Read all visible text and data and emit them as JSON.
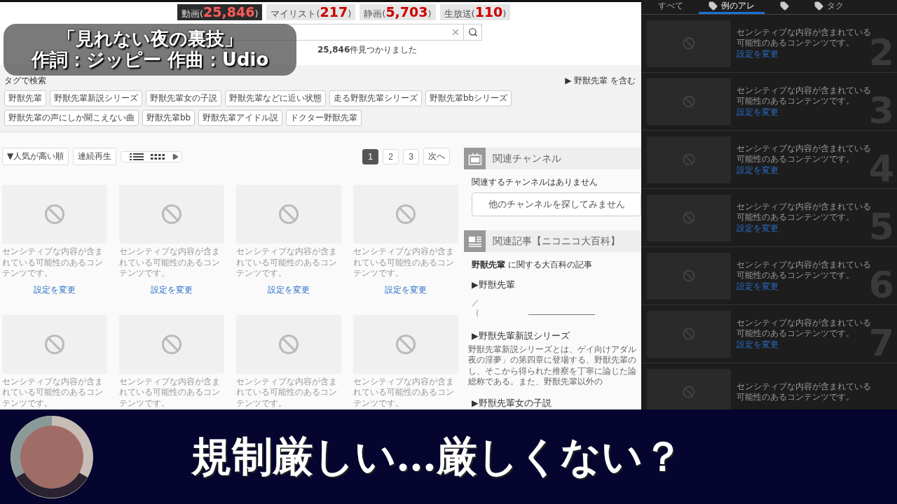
{
  "caption": {
    "title": "「見れない夜の裏技」",
    "credits": "作詞：ジッピー 作曲：Udio"
  },
  "count_tabs": [
    {
      "label": "動画(",
      "count": "25,846",
      "suffix": ")",
      "selected": true
    },
    {
      "label": "マイリスト(",
      "count": "217",
      "suffix": ")",
      "selected": false
    },
    {
      "label": "静画(",
      "count": "5,703",
      "suffix": ")",
      "selected": false
    },
    {
      "label": "生放送(",
      "count": "110",
      "suffix": ")",
      "selected": false
    }
  ],
  "result_text": "**25,846**件見つかりました",
  "tag_search": {
    "title": "タグで検索",
    "related": "▶ 野獣先輩 を含む"
  },
  "tags": [
    "野獣先輩",
    "野獣先輩新説シリーズ",
    "野獣先輩女の子説",
    "野獣先輩などに近い状態",
    "走る野獣先輩シリーズ",
    "野獣先輩bbシリーズ",
    "野獣先輩の声にしか聞こえない曲",
    "野獣先輩bb",
    "野獣先輩アイドル説",
    "ドクター野獣先輩"
  ],
  "toolbar": {
    "sort": "▼人気が高い順",
    "continuous": "連続再生",
    "next": "次へ"
  },
  "pages": [
    {
      "label": "1",
      "selected": true
    },
    {
      "label": "2",
      "selected": false
    },
    {
      "label": "3",
      "selected": false
    }
  ],
  "videos": [
    {
      "notice": "センシティブな内容が含まれている可能性のあるコンテンツです。",
      "link": "設定を変更"
    },
    {
      "notice": "センシティブな内容が含まれている可能性のあるコンテンツです。",
      "link": "設定を変更"
    },
    {
      "notice": "センシティブな内容が含まれている可能性のあるコンテンツです。",
      "link": "設定を変更"
    },
    {
      "notice": "センシティブな内容が含まれている可能性のあるコンテンツです。",
      "link": "設定を変更"
    },
    {
      "notice": "センシティブな内容が含まれている可能性のあるコンテンツです。"
    },
    {
      "notice": "センシティブな内容が含まれている可能性のあるコンテンツです。"
    },
    {
      "notice": "センシティブな内容が含まれている可能性のあるコンテンツです。"
    },
    {
      "notice": "センシティブな内容が含まれている可能性のあるコンテンツです。"
    }
  ],
  "sidebar": {
    "channel_header": "関連チャンネル",
    "no_channel": "関連するチャンネルはありません",
    "channel_button": "他のチャンネルを探してみません",
    "article_header": "関連記事【ニコニコ大百科】",
    "article_intro": "**野獣先輩** に関する大百科の記事",
    "articles": [
      {
        "kind": "stub",
        "title": "▶野獣先輩",
        "lines": [
          "／",
          "｛"
        ]
      },
      {
        "kind": "summary",
        "title": "▶野獣先輩新説シリーズ",
        "lines": [
          "野獣先輩新説シリーズとは、ゲイ向けアダル",
          "夜の淫夢」の第四章に登場する、野獣先輩の",
          "し、そこから得られた推察を丁寧に論じた論",
          "総称である。また、野獣先輩以外の"
        ]
      },
      {
        "kind": "title",
        "title": "▶野獣先輩女の子説"
      }
    ]
  },
  "ranking": {
    "tabs": [
      {
        "label": "すべて",
        "icon": false,
        "selected": false
      },
      {
        "label": "例のアレ",
        "icon": true,
        "selected": true
      },
      {
        "icon": true,
        "selected": false
      },
      {
        "label": "タク",
        "icon": true,
        "selected": false
      }
    ],
    "items": [
      {
        "rank": "2",
        "notice": "センシティブな内容が含まれている可能性のあるコンテンツです。",
        "link": "設定を変更"
      },
      {
        "rank": "3",
        "notice": "センシティブな内容が含まれている可能性のあるコンテンツです。",
        "link": "設定を変更"
      },
      {
        "rank": "4",
        "notice": "センシティブな内容が含まれている可能性のあるコンテンツです。",
        "link": "設定を変更"
      },
      {
        "rank": "5",
        "notice": "センシティブな内容が含まれている可能性のあるコンテンツです。",
        "link": "設定を変更"
      },
      {
        "rank": "6",
        "notice": "センシティブな内容が含まれている可能性のあるコンテンツです。",
        "link": "設定を変更"
      },
      {
        "rank": "7",
        "notice": "センシティブな内容が含まれている可能性のあるコンテンツです。",
        "link": "設定を変更"
      },
      {
        "notice": "センシティブな内容が含まれている可能性のあるコンテンツです。"
      }
    ]
  },
  "banner": {
    "text": "規制厳しい…厳しくない？"
  }
}
